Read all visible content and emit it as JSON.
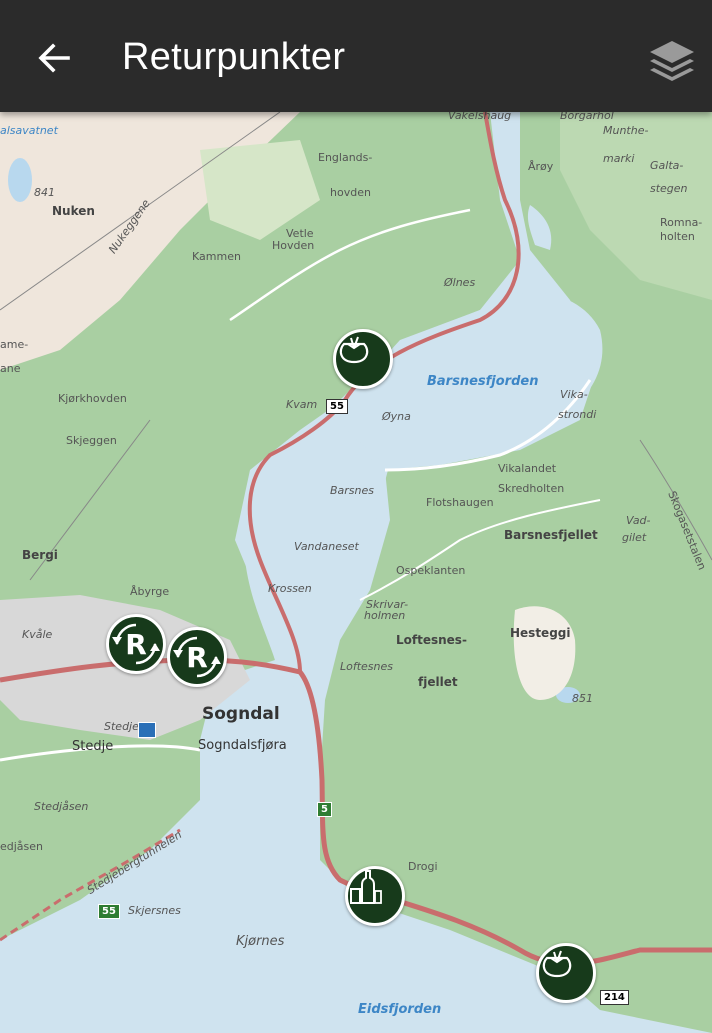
{
  "appbar": {
    "title": "Returpunkter"
  },
  "icons": {
    "back": "arrow-left-icon",
    "layers": "layers-icon"
  },
  "colors": {
    "appbar": "#2b2b2b",
    "water": "#cfe3ef",
    "forest": "#a9cfa2",
    "marker": "#173a1b"
  },
  "map": {
    "labels": {
      "vakelshaug": "Vakelshaug",
      "borgarhol": "Borgarhol",
      "muntheMarki1": "Munthe-",
      "muntheMarki2": "marki",
      "galta1": "Galta-",
      "galta2": "stegen",
      "aroy": "Årøy",
      "romna1": "Romna-",
      "romna2": "holten",
      "englands1": "Englands-",
      "englands2": "hovden",
      "nuken": "Nuken",
      "vetle1": "Vetle",
      "vetle2": "Hovden",
      "kammen": "Kammen",
      "nukeggene": "Nukeggene",
      "olnes": "Ølnes",
      "barsnesfjorden": "Barsnesfjorden",
      "vika1": "Vika-",
      "vika2": "strondi",
      "kvam": "Kvam",
      "oyna": "Øyna",
      "kjorkhovden": "Kjørkhovden",
      "skjeggen": "Skjeggen",
      "barsnes": "Barsnes",
      "flotshaugen": "Flotshaugen",
      "vikalandet": "Vikalandet",
      "skredholten": "Skredholten",
      "skogasetstalen": "Skogasetstalen",
      "bergi": "Bergi",
      "vandaneset": "Vandaneset",
      "barsnesfjellet": "Barsnesfjellet",
      "vad1": "Vad-",
      "vad2": "gilet",
      "abyrge": "Åbyrge",
      "krossen": "Krossen",
      "ospeklanten": "Ospeklanten",
      "skrivar1": "Skrivar-",
      "skrivar2": "holmen",
      "kvale": "Kvåle",
      "loftesnes1": "Loftesnes-",
      "loftesnes2": "fjellet",
      "hesteggi": "Hesteggi",
      "loftesnes": "Loftesnes",
      "sogndal": "Sogndal",
      "stedje": "Stedje",
      "stedje2": "Stedje",
      "sogndalsfjora": "Sogndalsfjøra",
      "n851": "851",
      "n841": "841",
      "stedjasen": "Stedjåsen",
      "edjasen": "edjåsen",
      "drogi": "Drogi",
      "stedjebergtunnelen": "Stedjebergtunnelen",
      "skjersnes": "Skjersnes",
      "kjornes": "Kjørnes",
      "eidsfjorden": "Eidsfjorden",
      "alsavatnet": "alsavatnet",
      "ame": "ame-",
      "ane": "ane"
    },
    "roads": {
      "r55a": "55",
      "r55b": "55",
      "r5": "5",
      "r214": "214"
    },
    "markers": [
      {
        "type": "bag",
        "icon": "bag-icon"
      },
      {
        "type": "recycling",
        "label": "R",
        "icon": "recycle-arrow-icon"
      },
      {
        "type": "recycling",
        "label": "R",
        "icon": "recycle-arrow-icon"
      },
      {
        "type": "bottles",
        "icon": "bottles-icon"
      },
      {
        "type": "bag",
        "icon": "bag-icon"
      }
    ]
  }
}
